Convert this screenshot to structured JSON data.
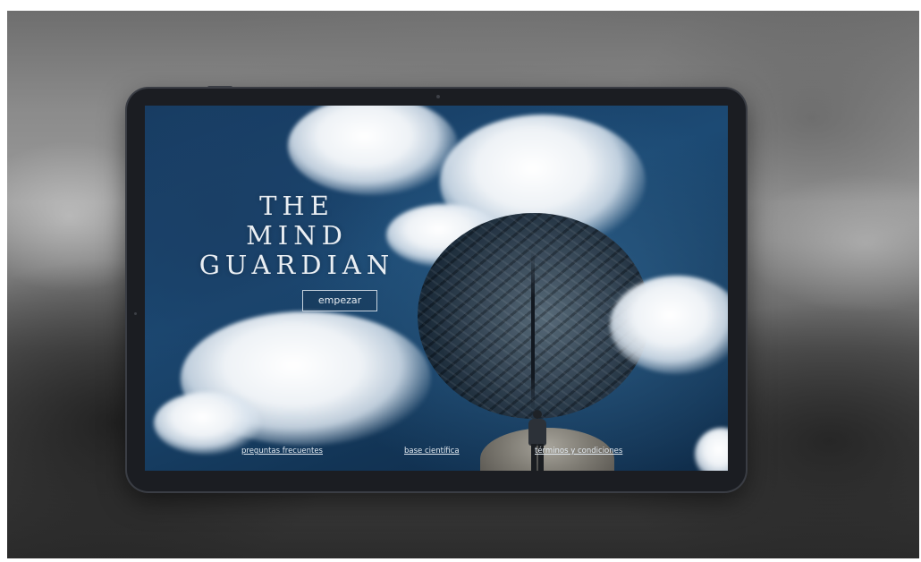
{
  "site": {
    "title_lines": [
      "THE",
      "MIND",
      "GUARDIAN"
    ],
    "start_button_label": "empezar"
  },
  "footer": {
    "links": [
      {
        "label": "preguntas frecuentes"
      },
      {
        "label": "base científica"
      },
      {
        "label": "términos y condiciones"
      }
    ]
  }
}
